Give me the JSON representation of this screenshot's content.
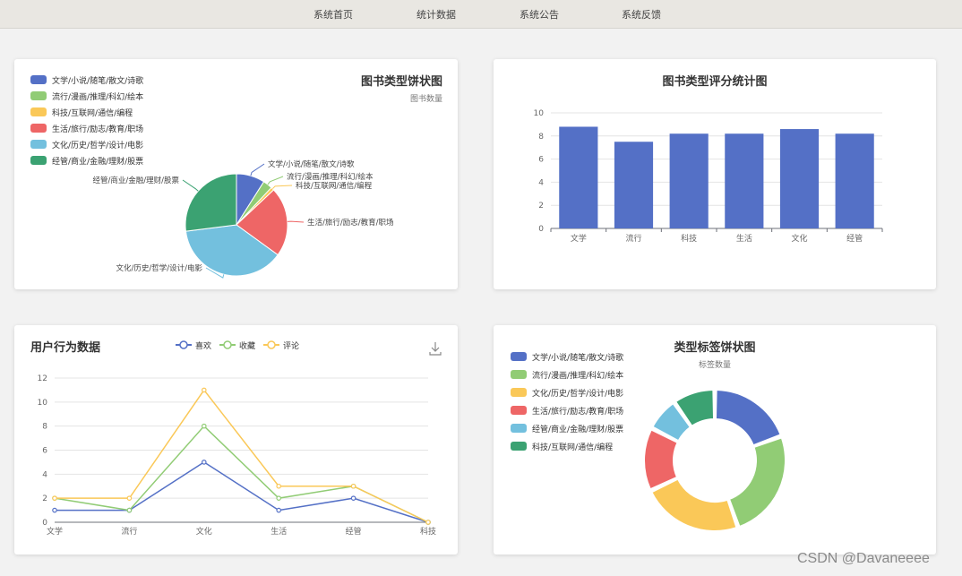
{
  "nav": {
    "items": [
      "系统首页",
      "统计数据",
      "系统公告",
      "系统反馈"
    ]
  },
  "watermark": "CSDN @Davaneeee",
  "colors": [
    "#5470c6",
    "#91cc75",
    "#fac858",
    "#ee6666",
    "#73c0de",
    "#3ba272"
  ],
  "chart_data": [
    {
      "type": "pie",
      "title": "图书类型饼状图",
      "subtitle": "图书数量",
      "legend_position": "top-left",
      "slices": [
        {
          "name": "文学/小说/随笔/散文/诗歌",
          "value": 9,
          "color": "#5470c6"
        },
        {
          "name": "流行/漫画/推理/科幻/绘本",
          "value": 3,
          "color": "#91cc75"
        },
        {
          "name": "科技/互联网/通信/编程",
          "value": 1,
          "color": "#fac858"
        },
        {
          "name": "生活/旅行/励志/教育/职场",
          "value": 22,
          "color": "#ee6666"
        },
        {
          "name": "文化/历史/哲学/设计/电影",
          "value": 38,
          "color": "#73c0de"
        },
        {
          "name": "经管/商业/金融/理财/股票",
          "value": 27,
          "color": "#3ba272"
        }
      ]
    },
    {
      "type": "bar",
      "title": "图书类型评分统计图",
      "categories": [
        "文学",
        "流行",
        "科技",
        "生活",
        "文化",
        "经管"
      ],
      "values": [
        8.8,
        7.5,
        8.2,
        8.2,
        8.6,
        8.2
      ],
      "ylim": [
        0,
        10
      ],
      "yticks": [
        0,
        2,
        4,
        6,
        8,
        10
      ],
      "grid": true,
      "color": "#5470c6"
    },
    {
      "type": "line",
      "title": "用户行为数据",
      "categories": [
        "文学",
        "流行",
        "文化",
        "生活",
        "经管",
        "科技"
      ],
      "ylim": [
        0,
        12
      ],
      "yticks": [
        0,
        2,
        4,
        6,
        8,
        10,
        12
      ],
      "grid": true,
      "legend_position": "top-center",
      "series": [
        {
          "name": "喜欢",
          "values": [
            1,
            1,
            5,
            1,
            2,
            0
          ],
          "color": "#5470c6"
        },
        {
          "name": "收藏",
          "values": [
            2,
            1,
            8,
            2,
            3,
            0
          ],
          "color": "#91cc75"
        },
        {
          "name": "评论",
          "values": [
            2,
            2,
            11,
            3,
            3,
            0
          ],
          "color": "#fac858"
        }
      ]
    },
    {
      "type": "pie",
      "subtype": "donut",
      "title": "类型标签饼状图",
      "subtitle": "标签数量",
      "legend_position": "top-left",
      "slices": [
        {
          "name": "文学/小说/随笔/散文/诗歌",
          "value": 20,
          "color": "#5470c6"
        },
        {
          "name": "流行/漫画/推理/科幻/绘本",
          "value": 26,
          "color": "#91cc75"
        },
        {
          "name": "文化/历史/哲学/设计/电影",
          "value": 24,
          "color": "#fac858"
        },
        {
          "name": "生活/旅行/励志/教育/职场",
          "value": 15,
          "color": "#ee6666"
        },
        {
          "name": "经管/商业/金融/理财/股票",
          "value": 8,
          "color": "#73c0de"
        },
        {
          "name": "科技/互联网/通信/编程",
          "value": 10,
          "color": "#3ba272"
        }
      ]
    }
  ]
}
